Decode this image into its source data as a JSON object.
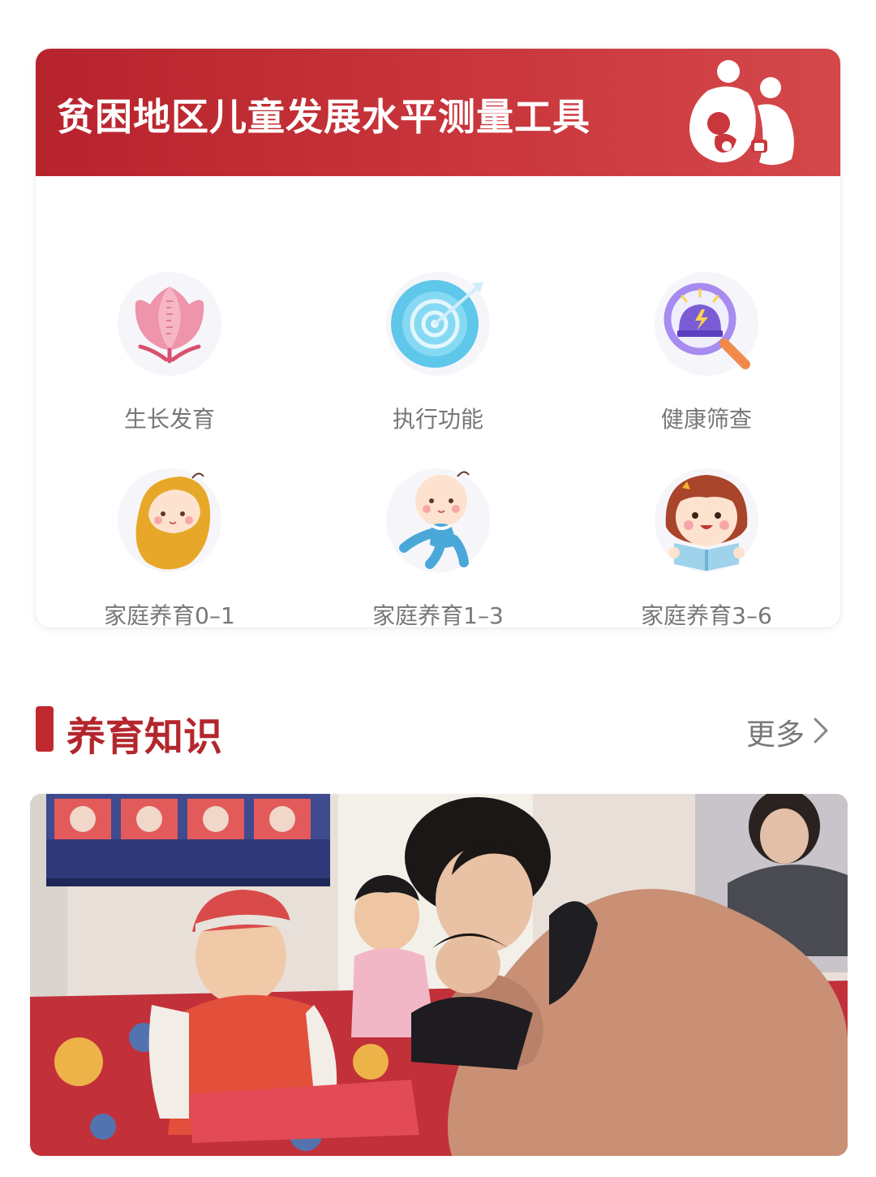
{
  "banner": {
    "title": "贫困地区儿童发展水平测量工具",
    "logo_icon": "family-logo-icon"
  },
  "tools": [
    {
      "label": "生长发育",
      "icon": "tulip-ruler-icon"
    },
    {
      "label": "执行功能",
      "icon": "target-icon"
    },
    {
      "label": "健康筛查",
      "icon": "alarm-magnifier-icon"
    },
    {
      "label": "家庭养育0–1",
      "icon": "swaddled-baby-icon"
    },
    {
      "label": "家庭养育1–3",
      "icon": "crawling-baby-icon"
    },
    {
      "label": "家庭养育3–6",
      "icon": "girl-reading-icon"
    }
  ],
  "section": {
    "title": "养育知识",
    "more_label": "更多"
  },
  "colors": {
    "brand_red": "#c0282f",
    "banner_gradient_end": "#d4484a"
  }
}
